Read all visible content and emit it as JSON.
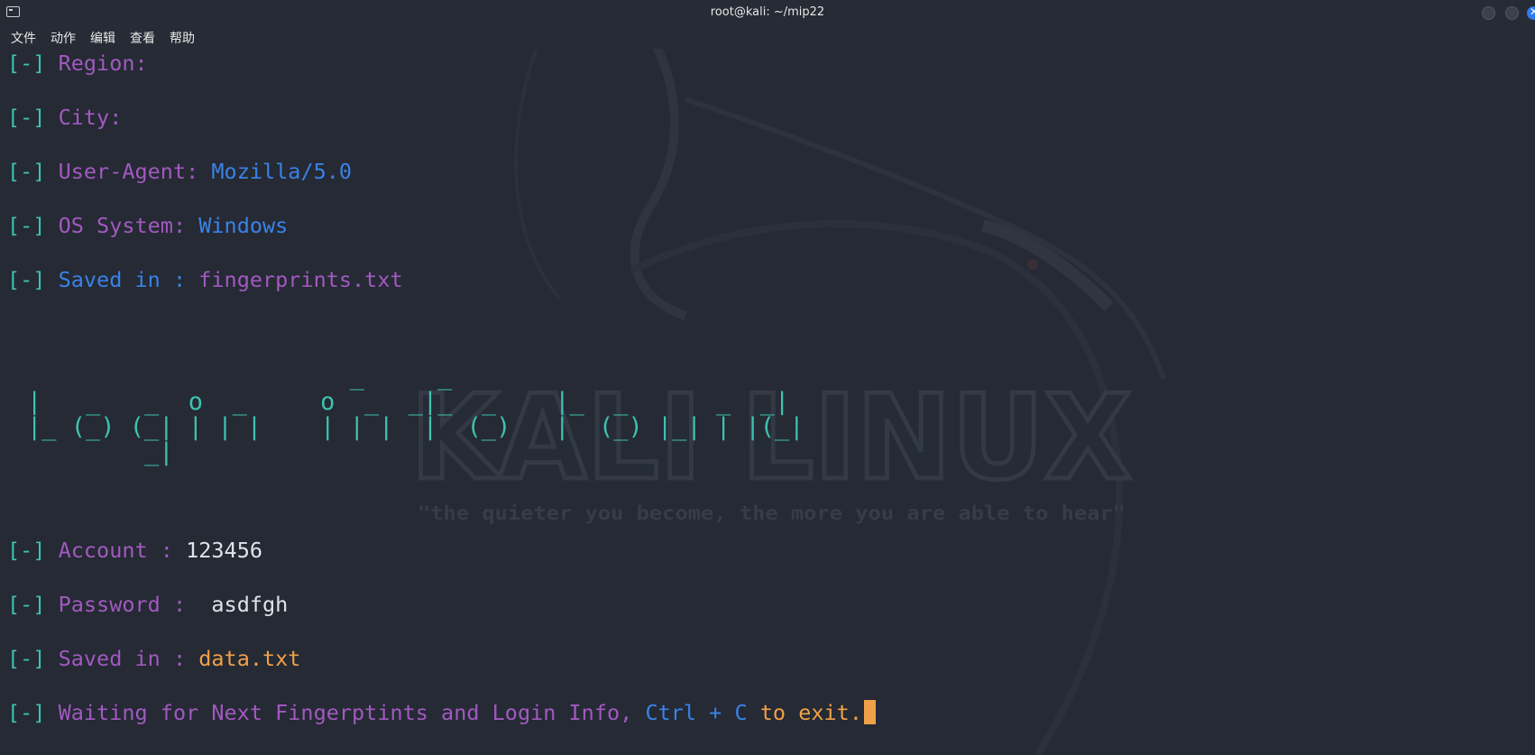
{
  "window": {
    "title": "root@kali: ~/mip22"
  },
  "menu": [
    "文件",
    "动作",
    "编辑",
    "查看",
    "帮助"
  ],
  "watermark": {
    "logo_text": "KALI LINUX",
    "tagline": "\"the quieter you become, the more you are able to hear\""
  },
  "terminal": {
    "bracket": "[-]",
    "lines": {
      "region": {
        "label": "Region:"
      },
      "city": {
        "label": "City:"
      },
      "user_agent": {
        "label": "User-Agent:",
        "value": "Mozilla/5.0"
      },
      "os_system": {
        "label": "OS System:",
        "value": "Windows"
      },
      "saved_fp": {
        "label": "Saved in :",
        "value": "fingerprints.txt"
      },
      "account": {
        "label": "Account :",
        "value": "123456"
      },
      "password": {
        "label": "Password :",
        "value": " asdfgh"
      },
      "saved_data": {
        "label": "Saved in :",
        "value": "data.txt"
      },
      "waiting": {
        "part1": "Waiting for Next Fingerptints and Login Info,",
        "part2": "Ctrl + C",
        "part3": "to exit."
      }
    },
    "banner": {
      "text": "Login Info Found",
      "art": "                      _     _\n|   _   _  o  _     o  _  _|_  _    |_  _      _  _|\n|_ (_) (_| | | |    | | |  |  (_)   |  (_) |_| | |(_|\n        _|"
    },
    "cursor_color": "#f0a048"
  },
  "colors": {
    "background": "#252a34",
    "bracket": "#3fc1b0",
    "label": "#a259c0",
    "value_blue": "#3a82e8",
    "value_orange": "#f0a048",
    "close_button": "#2f7af0"
  }
}
